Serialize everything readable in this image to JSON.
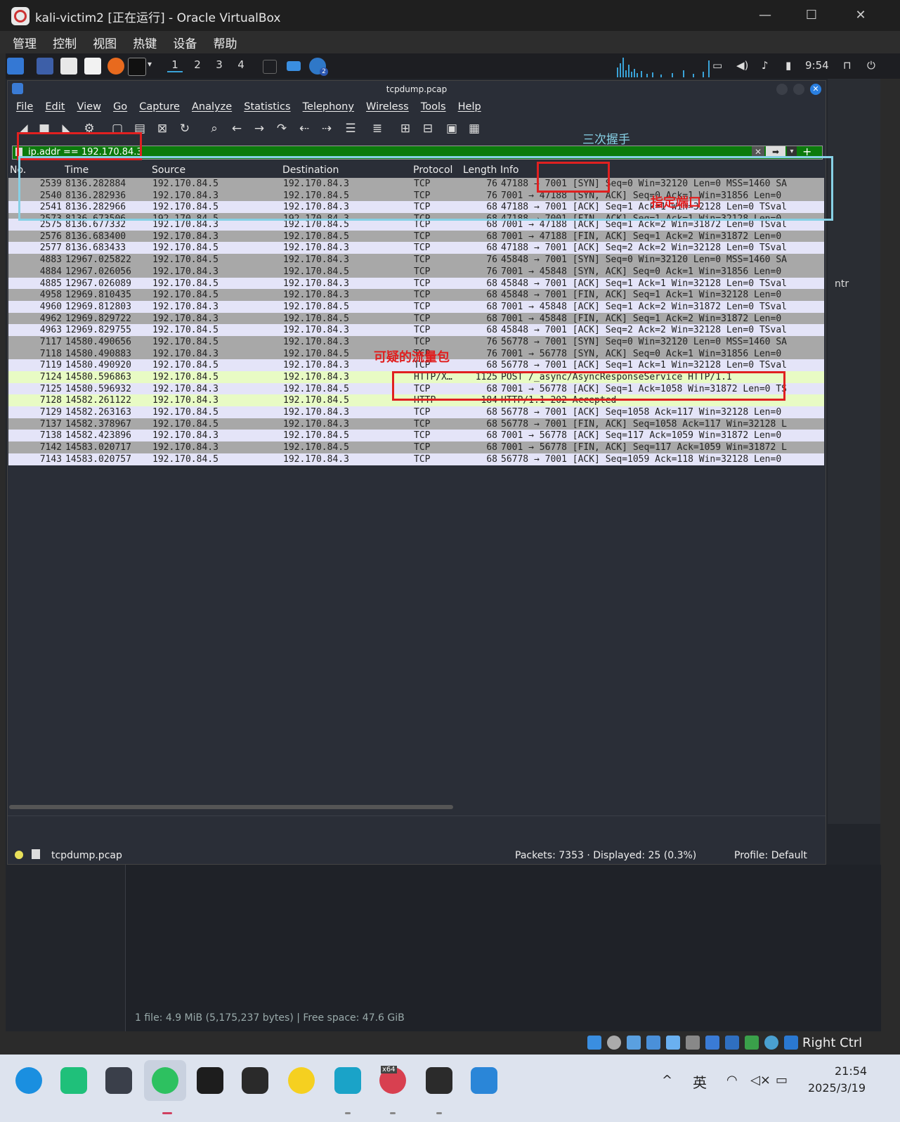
{
  "vbox": {
    "title": "kali-victim2 [正在运行] - Oracle VirtualBox",
    "menu": [
      "管理",
      "控制",
      "视图",
      "热键",
      "设备",
      "帮助"
    ],
    "controls": [
      "—",
      "☐",
      "✕"
    ],
    "host_key": "Right Ctrl"
  },
  "kali": {
    "workspaces": [
      "1",
      "2",
      "3",
      "4"
    ],
    "clock": "9:54",
    "badge": "2"
  },
  "wireshark": {
    "title": "tcpdump.pcap",
    "menu": [
      "File",
      "Edit",
      "View",
      "Go",
      "Capture",
      "Analyze",
      "Statistics",
      "Telephony",
      "Wireless",
      "Tools",
      "Help"
    ],
    "filter": "ip.addr == 192.170.84.3",
    "columns": [
      "No.",
      "Time",
      "Source",
      "Destination",
      "Protocol",
      "Length",
      "Info"
    ],
    "rows": [
      {
        "no": "2539",
        "time": "8136.282884",
        "src": "192.170.84.5",
        "dst": "192.170.84.3",
        "proto": "TCP",
        "len": "76",
        "info": "47188 → 7001 [SYN] Seq=0 Win=32120 Len=0 MSS=1460 SA",
        "style": "gray"
      },
      {
        "no": "2540",
        "time": "8136.282936",
        "src": "192.170.84.3",
        "dst": "192.170.84.5",
        "proto": "TCP",
        "len": "76",
        "info": "7001 → 47188 [SYN, ACK] Seq=0 Ack=1 Win=31856 Len=0",
        "style": "gray"
      },
      {
        "no": "2541",
        "time": "8136.282966",
        "src": "192.170.84.5",
        "dst": "192.170.84.3",
        "proto": "TCP",
        "len": "68",
        "info": "47188 → 7001 [ACK] Seq=1 Ack=1 Win=32128 Len=0 TSval",
        "style": "lav"
      },
      {
        "no": "2573",
        "time": "8136.673506",
        "src": "192.170.84.5",
        "dst": "192.170.84.3",
        "proto": "TCP",
        "len": "68",
        "info": "47188 → 7001 [FIN, ACK] Seq=1 Ack=1 Win=32128 Len=0",
        "style": "gray half"
      },
      {
        "no": "2575",
        "time": "8136.677332",
        "src": "192.170.84.3",
        "dst": "192.170.84.5",
        "proto": "TCP",
        "len": "68",
        "info": "7001 → 47188 [ACK] Seq=1 Ack=2 Win=31872 Len=0 TSval",
        "style": "lav"
      },
      {
        "no": "2576",
        "time": "8136.683400",
        "src": "192.170.84.3",
        "dst": "192.170.84.5",
        "proto": "TCP",
        "len": "68",
        "info": "7001 → 47188 [FIN, ACK] Seq=1 Ack=2 Win=31872 Len=0",
        "style": "gray"
      },
      {
        "no": "2577",
        "time": "8136.683433",
        "src": "192.170.84.5",
        "dst": "192.170.84.3",
        "proto": "TCP",
        "len": "68",
        "info": "47188 → 7001 [ACK] Seq=2 Ack=2 Win=32128 Len=0 TSval",
        "style": "lav"
      },
      {
        "no": "4883",
        "time": "12967.025822",
        "src": "192.170.84.5",
        "dst": "192.170.84.3",
        "proto": "TCP",
        "len": "76",
        "info": "45848 → 7001 [SYN] Seq=0 Win=32120 Len=0 MSS=1460 SA",
        "style": "gray"
      },
      {
        "no": "4884",
        "time": "12967.026056",
        "src": "192.170.84.3",
        "dst": "192.170.84.5",
        "proto": "TCP",
        "len": "76",
        "info": "7001 → 45848 [SYN, ACK] Seq=0 Ack=1 Win=31856 Len=0",
        "style": "gray"
      },
      {
        "no": "4885",
        "time": "12967.026089",
        "src": "192.170.84.5",
        "dst": "192.170.84.3",
        "proto": "TCP",
        "len": "68",
        "info": "45848 → 7001 [ACK] Seq=1 Ack=1 Win=32128 Len=0 TSval",
        "style": "lav"
      },
      {
        "no": "4958",
        "time": "12969.810435",
        "src": "192.170.84.5",
        "dst": "192.170.84.3",
        "proto": "TCP",
        "len": "68",
        "info": "45848 → 7001 [FIN, ACK] Seq=1 Ack=1 Win=32128 Len=0",
        "style": "gray"
      },
      {
        "no": "4960",
        "time": "12969.812803",
        "src": "192.170.84.3",
        "dst": "192.170.84.5",
        "proto": "TCP",
        "len": "68",
        "info": "7001 → 45848 [ACK] Seq=1 Ack=2 Win=31872 Len=0 TSval",
        "style": "lav"
      },
      {
        "no": "4962",
        "time": "12969.829722",
        "src": "192.170.84.3",
        "dst": "192.170.84.5",
        "proto": "TCP",
        "len": "68",
        "info": "7001 → 45848 [FIN, ACK] Seq=1 Ack=2 Win=31872 Len=0",
        "style": "gray"
      },
      {
        "no": "4963",
        "time": "12969.829755",
        "src": "192.170.84.5",
        "dst": "192.170.84.3",
        "proto": "TCP",
        "len": "68",
        "info": "45848 → 7001 [ACK] Seq=2 Ack=2 Win=32128 Len=0 TSval",
        "style": "lav"
      },
      {
        "no": "7117",
        "time": "14580.490656",
        "src": "192.170.84.5",
        "dst": "192.170.84.3",
        "proto": "TCP",
        "len": "76",
        "info": "56778 → 7001 [SYN] Seq=0 Win=32120 Len=0 MSS=1460 SA",
        "style": "gray"
      },
      {
        "no": "7118",
        "time": "14580.490883",
        "src": "192.170.84.3",
        "dst": "192.170.84.5",
        "proto": "TCP",
        "len": "76",
        "info": "7001 → 56778 [SYN, ACK] Seq=0 Ack=1 Win=31856 Len=0",
        "style": "gray"
      },
      {
        "no": "7119",
        "time": "14580.490920",
        "src": "192.170.84.5",
        "dst": "192.170.84.3",
        "proto": "TCP",
        "len": "68",
        "info": "56778 → 7001 [ACK] Seq=1 Ack=1 Win=32128 Len=0 TSval",
        "style": "lav"
      },
      {
        "no": "7124",
        "time": "14580.596863",
        "src": "192.170.84.5",
        "dst": "192.170.84.3",
        "proto": "HTTP/X…",
        "len": "1125",
        "info": "POST /_async/AsyncResponseService HTTP/1.1",
        "style": "http"
      },
      {
        "no": "7125",
        "time": "14580.596932",
        "src": "192.170.84.3",
        "dst": "192.170.84.5",
        "proto": "TCP",
        "len": "68",
        "info": "7001 → 56778 [ACK] Seq=1 Ack=1058 Win=31872 Len=0 TS",
        "style": "lav"
      },
      {
        "no": "7128",
        "time": "14582.261122",
        "src": "192.170.84.3",
        "dst": "192.170.84.5",
        "proto": "HTTP",
        "len": "184",
        "info": "HTTP/1.1 202 Accepted",
        "style": "http"
      },
      {
        "no": "7129",
        "time": "14582.263163",
        "src": "192.170.84.5",
        "dst": "192.170.84.3",
        "proto": "TCP",
        "len": "68",
        "info": "56778 → 7001 [ACK] Seq=1058 Ack=117 Win=32128 Len=0",
        "style": "lav"
      },
      {
        "no": "7137",
        "time": "14582.378967",
        "src": "192.170.84.5",
        "dst": "192.170.84.3",
        "proto": "TCP",
        "len": "68",
        "info": "56778 → 7001 [FIN, ACK] Seq=1058 Ack=117 Win=32128 L",
        "style": "gray"
      },
      {
        "no": "7138",
        "time": "14582.423896",
        "src": "192.170.84.3",
        "dst": "192.170.84.5",
        "proto": "TCP",
        "len": "68",
        "info": "7001 → 56778 [ACK] Seq=117 Ack=1059 Win=31872 Len=0",
        "style": "lav"
      },
      {
        "no": "7142",
        "time": "14583.020717",
        "src": "192.170.84.3",
        "dst": "192.170.84.5",
        "proto": "TCP",
        "len": "68",
        "info": "7001 → 56778 [FIN, ACK] Seq=117 Ack=1059 Win=31872 L",
        "style": "gray"
      },
      {
        "no": "7143",
        "time": "14583.020757",
        "src": "192.170.84.5",
        "dst": "192.170.84.3",
        "proto": "TCP",
        "len": "68",
        "info": "56778 → 7001 [ACK] Seq=1059 Ack=118 Win=32128 Len=0",
        "style": "lav"
      }
    ],
    "status": {
      "file": "tcpdump.pcap",
      "packets": "Packets: 7353 · Displayed: 25 (0.3%)",
      "profile": "Profile: Default"
    }
  },
  "file_manager_status": "1 file: 4.9 MiB (5,175,237 bytes)  |  Free space: 47.6 GiB",
  "right_panel_label": "ntr",
  "annotations": {
    "handshake": "三次握手",
    "port": "指定端口",
    "suspicious": "可疑的流量包"
  },
  "taskbar": {
    "ime": "英",
    "time": "21:54",
    "date": "2025/3/19",
    "x64_badge": "x64"
  }
}
